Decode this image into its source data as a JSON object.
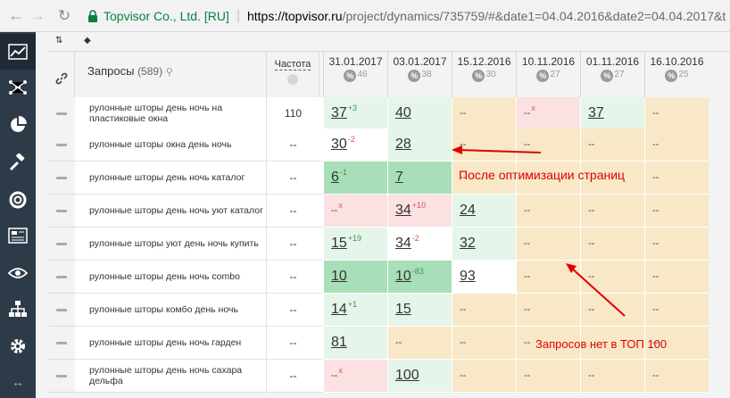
{
  "browser": {
    "secure_label": "Topvisor Co., Ltd. [RU]",
    "url_host": "https://topvisor.ru",
    "url_rest": "/project/dynamics/735759/#&date1=04.04.2016&date2=04.04.2017&t"
  },
  "toolbar": {
    "sort_icon": "sort-icon",
    "tag_icon": "tag-icon"
  },
  "table": {
    "query_header": "Запросы",
    "query_count": "(589)",
    "freq_header": "Частота",
    "dates": [
      {
        "date": "31.01.2017",
        "pct": "46"
      },
      {
        "date": "03.01.2017",
        "pct": "38"
      },
      {
        "date": "15.12.2016",
        "pct": "30"
      },
      {
        "date": "10.11.2016",
        "pct": "27"
      },
      {
        "date": "01.11.2016",
        "pct": "27"
      },
      {
        "date": "16.10.2016",
        "pct": "25"
      }
    ],
    "rows": [
      {
        "query": "рулонные шторы день ночь на пластиковые окна",
        "freq": "110",
        "cells": [
          {
            "v": "37",
            "d": "+3",
            "dir": "up",
            "c": "c-green"
          },
          {
            "v": "40",
            "d": "",
            "dir": "",
            "c": "c-green"
          },
          {
            "v": "--",
            "d": "",
            "dir": "",
            "c": "c-beige"
          },
          {
            "v": "--",
            "d": "x",
            "dir": "down",
            "c": "c-pink"
          },
          {
            "v": "37",
            "d": "",
            "dir": "",
            "c": "c-green"
          },
          {
            "v": "--",
            "d": "",
            "dir": "",
            "c": "c-beige"
          }
        ]
      },
      {
        "query": "рулонные шторы окна день ночь",
        "freq": "--",
        "cells": [
          {
            "v": "30",
            "d": "-2",
            "dir": "down",
            "c": "c-white"
          },
          {
            "v": "28",
            "d": "",
            "dir": "",
            "c": "c-green"
          },
          {
            "v": "--",
            "d": "",
            "dir": "",
            "c": "c-beige"
          },
          {
            "v": "--",
            "d": "",
            "dir": "",
            "c": "c-beige"
          },
          {
            "v": "--",
            "d": "",
            "dir": "",
            "c": "c-beige"
          },
          {
            "v": "--",
            "d": "",
            "dir": "",
            "c": "c-beige"
          }
        ]
      },
      {
        "query": "рулонные шторы день ночь каталог",
        "freq": "--",
        "cells": [
          {
            "v": "6",
            "d": "-1",
            "dir": "up",
            "c": "c-dgreen"
          },
          {
            "v": "7",
            "d": "",
            "dir": "",
            "c": "c-dgreen"
          },
          {
            "v": "--",
            "d": "",
            "dir": "",
            "c": "c-beige"
          },
          {
            "v": "",
            "d": "",
            "dir": "",
            "c": "c-beige"
          },
          {
            "v": "",
            "d": "",
            "dir": "",
            "c": "c-beige"
          },
          {
            "v": "--",
            "d": "",
            "dir": "",
            "c": "c-beige"
          }
        ]
      },
      {
        "query": "рулонные шторы день ночь уют каталог",
        "freq": "--",
        "cells": [
          {
            "v": "--",
            "d": "x",
            "dir": "down",
            "c": "c-pink"
          },
          {
            "v": "34",
            "d": "+10",
            "dir": "down",
            "c": "c-pink"
          },
          {
            "v": "24",
            "d": "",
            "dir": "",
            "c": "c-green"
          },
          {
            "v": "--",
            "d": "",
            "dir": "",
            "c": "c-beige"
          },
          {
            "v": "--",
            "d": "",
            "dir": "",
            "c": "c-beige"
          },
          {
            "v": "--",
            "d": "",
            "dir": "",
            "c": "c-beige"
          }
        ]
      },
      {
        "query": "рулонные шторы уют день ночь купить",
        "freq": "--",
        "cells": [
          {
            "v": "15",
            "d": "+19",
            "dir": "up",
            "c": "c-green"
          },
          {
            "v": "34",
            "d": "-2",
            "dir": "down",
            "c": "c-white"
          },
          {
            "v": "32",
            "d": "",
            "dir": "",
            "c": "c-green"
          },
          {
            "v": "--",
            "d": "",
            "dir": "",
            "c": "c-beige"
          },
          {
            "v": "--",
            "d": "",
            "dir": "",
            "c": "c-beige"
          },
          {
            "v": "--",
            "d": "",
            "dir": "",
            "c": "c-beige"
          }
        ]
      },
      {
        "query": "рулонные шторы день ночь combo",
        "freq": "--",
        "cells": [
          {
            "v": "10",
            "d": "",
            "dir": "",
            "c": "c-dgreen"
          },
          {
            "v": "10",
            "d": "-83",
            "dir": "up",
            "c": "c-dgreen"
          },
          {
            "v": "93",
            "d": "",
            "dir": "",
            "c": "c-white"
          },
          {
            "v": "--",
            "d": "",
            "dir": "",
            "c": "c-beige"
          },
          {
            "v": "--",
            "d": "",
            "dir": "",
            "c": "c-beige"
          },
          {
            "v": "--",
            "d": "",
            "dir": "",
            "c": "c-beige"
          }
        ]
      },
      {
        "query": "рулонные шторы комбо день ночь",
        "freq": "--",
        "cells": [
          {
            "v": "14",
            "d": "+1",
            "dir": "up",
            "c": "c-green"
          },
          {
            "v": "15",
            "d": "",
            "dir": "",
            "c": "c-green"
          },
          {
            "v": "--",
            "d": "",
            "dir": "",
            "c": "c-beige"
          },
          {
            "v": "--",
            "d": "",
            "dir": "",
            "c": "c-beige"
          },
          {
            "v": "--",
            "d": "",
            "dir": "",
            "c": "c-beige"
          },
          {
            "v": "--",
            "d": "",
            "dir": "",
            "c": "c-beige"
          }
        ]
      },
      {
        "query": "рулонные шторы день ночь гарден",
        "freq": "--",
        "cells": [
          {
            "v": "81",
            "d": "",
            "dir": "",
            "c": "c-green"
          },
          {
            "v": "--",
            "d": "",
            "dir": "",
            "c": "c-beige"
          },
          {
            "v": "--",
            "d": "",
            "dir": "",
            "c": "c-beige"
          },
          {
            "v": "--",
            "d": "",
            "dir": "",
            "c": "c-beige"
          },
          {
            "v": "",
            "d": "",
            "dir": "",
            "c": "c-beige"
          },
          {
            "v": "--",
            "d": "",
            "dir": "",
            "c": "c-beige"
          }
        ]
      },
      {
        "query": "рулонные шторы день ночь сахара дельфа",
        "freq": "--",
        "cells": [
          {
            "v": "--",
            "d": "x",
            "dir": "down",
            "c": "c-pink"
          },
          {
            "v": "100",
            "d": "",
            "dir": "",
            "c": "c-green"
          },
          {
            "v": "--",
            "d": "",
            "dir": "",
            "c": "c-beige"
          },
          {
            "v": "--",
            "d": "",
            "dir": "",
            "c": "c-beige"
          },
          {
            "v": "--",
            "d": "",
            "dir": "",
            "c": "c-beige"
          },
          {
            "v": "--",
            "d": "",
            "dir": "",
            "c": "c-beige"
          }
        ]
      }
    ]
  },
  "annotations": {
    "after_optimization": "После оптимизации страниц",
    "no_queries_top100": "Запросов нет в ТОП 100"
  },
  "sidebar_icons": [
    "chart-icon",
    "network-icon",
    "pie-chart-icon",
    "gavel-icon",
    "lifebuoy-icon",
    "newspaper-icon",
    "eye-icon",
    "sitemap-icon",
    "settings-icon"
  ],
  "colors": {
    "sidebar": "#2d3a48",
    "secure": "#0b8043",
    "annotation": "#e10000"
  }
}
